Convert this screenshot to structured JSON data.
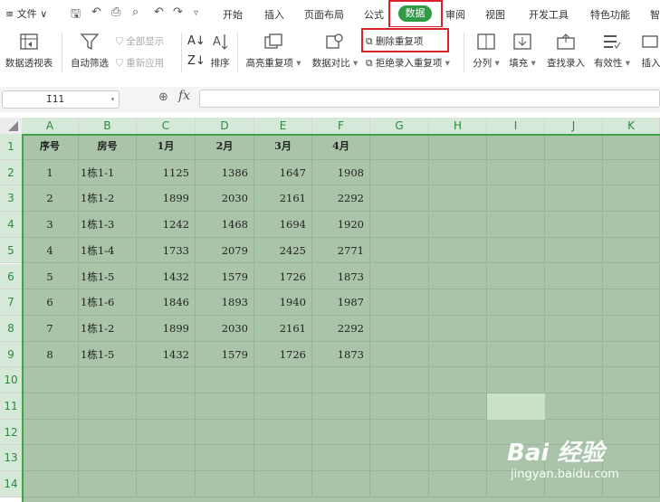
{
  "menu": {
    "file": "≡ 文件 ∨",
    "tabs": [
      "开始",
      "插入",
      "页面布局",
      "公式",
      "数据",
      "审阅",
      "视图",
      "开发工具",
      "特色功能",
      "智"
    ],
    "active_tab": "数据"
  },
  "ribbon": {
    "pivot": "数据透视表",
    "autofilter": "自动筛选",
    "show_all": "全部显示",
    "reapply": "重新应用",
    "sort": "排序",
    "highlight_dup": "高亮重复项",
    "compare": "数据对比",
    "remove_dup": "删除重复项",
    "reject_dup": "拒绝录入重复项",
    "split": "分列",
    "fill": "填充",
    "find_enter": "查找录入",
    "validity": "有效性",
    "insert": "插入"
  },
  "formula_bar": {
    "name_box": "I11",
    "fx": "fx",
    "value": ""
  },
  "columns": [
    "A",
    "B",
    "C",
    "D",
    "E",
    "F",
    "G",
    "H",
    "I",
    "J",
    "K"
  ],
  "rows": [
    "1",
    "2",
    "3",
    "4",
    "5",
    "6",
    "7",
    "8",
    "9",
    "10",
    "11",
    "12",
    "13",
    "14"
  ],
  "table": {
    "headers": [
      "序号",
      "房号",
      "1月",
      "2月",
      "3月",
      "4月"
    ],
    "data": [
      [
        "1",
        "1栋1-1",
        "1125",
        "1386",
        "1647",
        "1908"
      ],
      [
        "2",
        "1栋1-2",
        "1899",
        "2030",
        "2161",
        "2292"
      ],
      [
        "3",
        "1栋1-3",
        "1242",
        "1468",
        "1694",
        "1920"
      ],
      [
        "4",
        "1栋1-4",
        "1733",
        "2079",
        "2425",
        "2771"
      ],
      [
        "5",
        "1栋1-5",
        "1432",
        "1579",
        "1726",
        "1873"
      ],
      [
        "6",
        "1栋1-6",
        "1846",
        "1893",
        "1940",
        "1987"
      ],
      [
        "7",
        "1栋1-2",
        "1899",
        "2030",
        "2161",
        "2292"
      ],
      [
        "8",
        "1栋1-5",
        "1432",
        "1579",
        "1726",
        "1873"
      ]
    ]
  },
  "watermark": {
    "logo": "Bai 经验",
    "url": "jingyan.baidu.com"
  },
  "colors": {
    "accent": "#2f9b44",
    "highlight": "#d8232a",
    "selection_fill": "#a9c4a9"
  }
}
